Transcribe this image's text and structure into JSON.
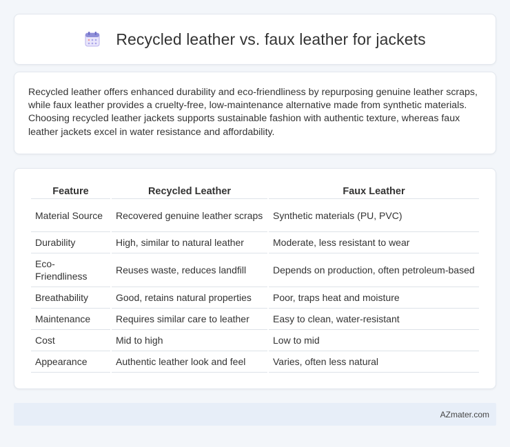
{
  "header": {
    "title": "Recycled leather vs. faux leather for jackets",
    "icon": "calendar-icon"
  },
  "summary": {
    "text": "Recycled leather offers enhanced durability and eco-friendliness by repurposing genuine leather scraps, while faux leather provides a cruelty-free, low-maintenance alternative made from synthetic materials. Choosing recycled leather jackets supports sustainable fashion with authentic texture, whereas faux leather jackets excel in water resistance and affordability."
  },
  "table": {
    "headers": [
      "Feature",
      "Recycled Leather",
      "Faux Leather"
    ],
    "rows": [
      [
        "Material Source",
        "Recovered genuine leather scraps",
        "Synthetic materials (PU, PVC)"
      ],
      [
        "Durability",
        "High, similar to natural leather",
        "Moderate, less resistant to wear"
      ],
      [
        "Eco-Friendliness",
        "Reuses waste, reduces landfill",
        "Depends on production, often petroleum-based"
      ],
      [
        "Breathability",
        "Good, retains natural properties",
        "Poor, traps heat and moisture"
      ],
      [
        "Maintenance",
        "Requires similar care to leather",
        "Easy to clean, water-resistant"
      ],
      [
        "Cost",
        "Mid to high",
        "Low to mid"
      ],
      [
        "Appearance",
        "Authentic leather look and feel",
        "Varies, often less natural"
      ]
    ]
  },
  "footer": {
    "text": "AZmater.com"
  },
  "colors": {
    "page_background": "#f3f6fa",
    "footer_background": "#e7eef8",
    "icon_accent": "#8f8fd8"
  }
}
